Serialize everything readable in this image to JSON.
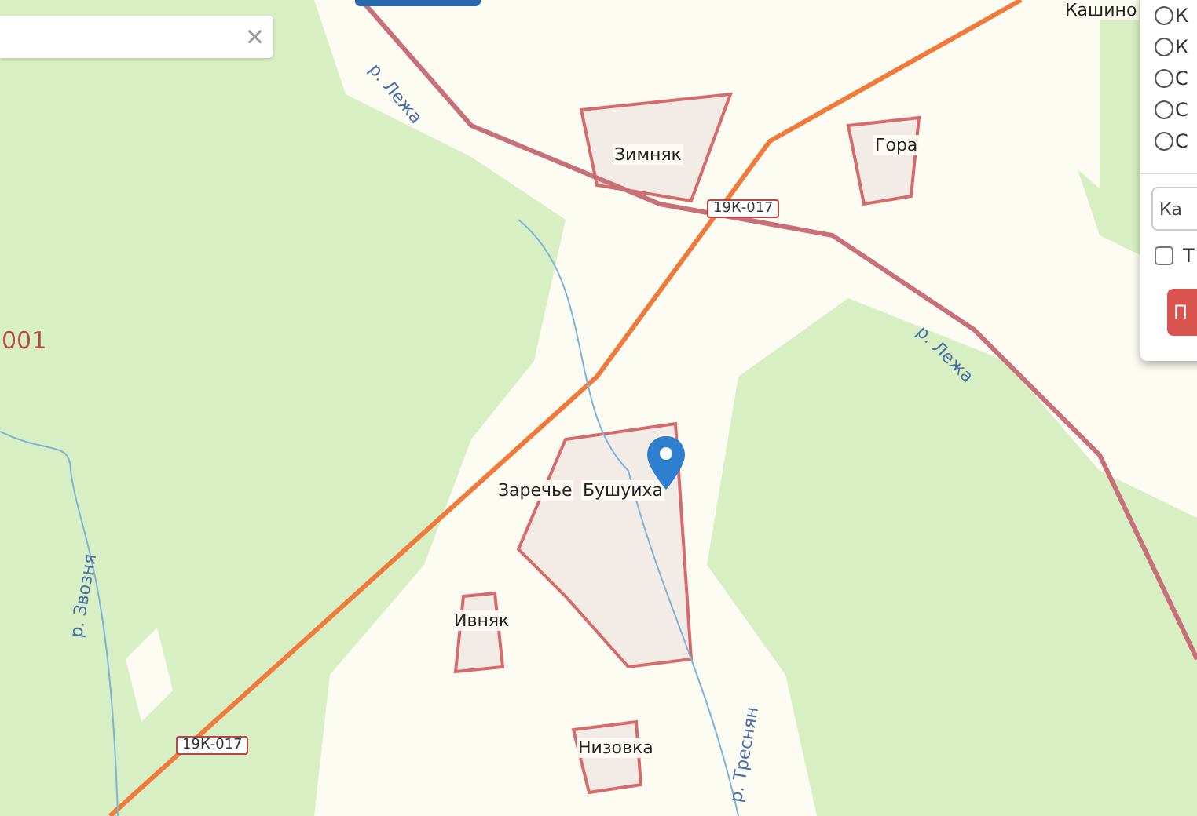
{
  "search": {
    "clear": "×"
  },
  "map": {
    "labels": [
      {
        "kind": "place",
        "text": "Кашино"
      },
      {
        "kind": "place",
        "text": "Зимняк"
      },
      {
        "kind": "place",
        "text": "Гора"
      },
      {
        "kind": "road",
        "text": "19К-017"
      },
      {
        "kind": "river",
        "text": "р. Лежа"
      },
      {
        "kind": "river",
        "text": "р. Лежа"
      },
      {
        "kind": "code",
        "text": "001"
      },
      {
        "kind": "place",
        "text": "Заречье"
      },
      {
        "kind": "place",
        "text": "Бушуиха"
      },
      {
        "kind": "river",
        "text": "р. Звозня"
      },
      {
        "kind": "place",
        "text": "Ивняк"
      },
      {
        "kind": "road",
        "text": "19К-017"
      },
      {
        "kind": "place",
        "text": "Низовка"
      },
      {
        "kind": "river",
        "text": "р. Треснян"
      }
    ]
  },
  "panel": {
    "options": [
      {
        "label": "К",
        "selected": false
      },
      {
        "label": "К",
        "selected": false
      },
      {
        "label": "С",
        "selected": false
      },
      {
        "label": "С",
        "selected": false
      },
      {
        "label": "С",
        "selected": false
      }
    ],
    "cadastre": {
      "placeholder": "Ка"
    },
    "checkbox": {
      "label": "Т",
      "checked": false
    },
    "submit": "П"
  }
}
